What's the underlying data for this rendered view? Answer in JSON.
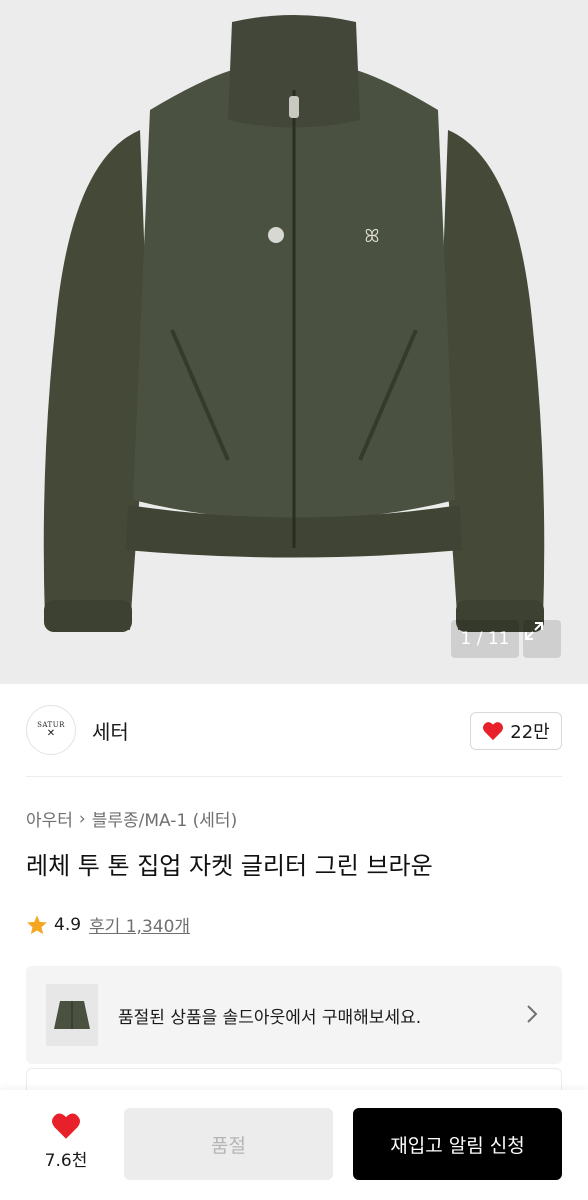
{
  "gallery": {
    "counter": "1 / 11",
    "image_alt": "olive green zip-up jacket"
  },
  "brand": {
    "logo_text": "SATUR",
    "name": "세터",
    "likes": "22만"
  },
  "product": {
    "breadcrumb": [
      "아우터",
      "블루종/MA-1 (세터)"
    ],
    "title": "레체 투 톤 집업 자켓 글리터 그린 브라운",
    "rating": "4.9",
    "reviews": "후기 1,340개"
  },
  "soldout_banner": {
    "text": "품절된 상품을 솔드아웃에서 구매해보세요."
  },
  "bottom_bar": {
    "wish_count": "7.6천",
    "soldout_label": "품절",
    "restock_label": "재입고 알림 신청"
  },
  "colors": {
    "accent_red": "#e8202a",
    "star": "#f5a623",
    "jacket": "#4a4f3c"
  }
}
